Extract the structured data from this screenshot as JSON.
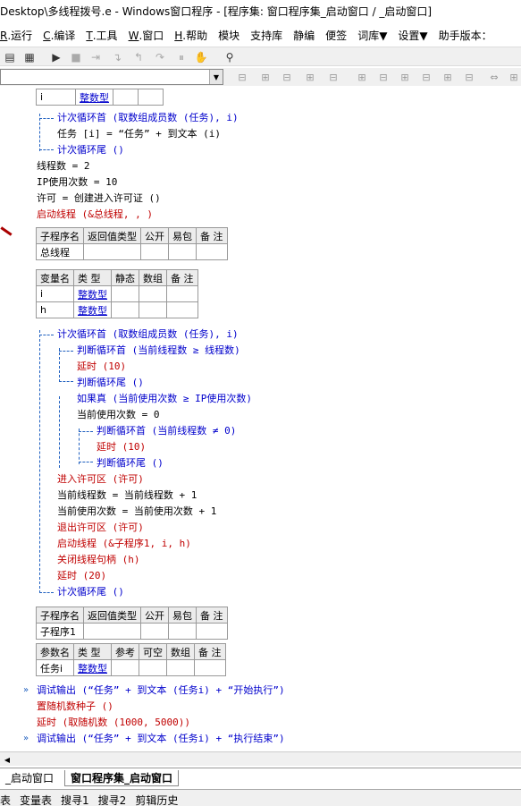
{
  "window": {
    "title": "Desktop\\多线程拨号.e - Windows窗口程序 - [程序集: 窗口程序集_启动窗口 / _启动窗口]"
  },
  "menu": {
    "items": [
      {
        "key": "R",
        "label": ".运行"
      },
      {
        "key": "C",
        "label": ".编译"
      },
      {
        "key": "T",
        "label": ".工具"
      },
      {
        "key": "W",
        "label": ".窗口"
      },
      {
        "key": "H",
        "label": ".帮助"
      },
      {
        "key": "",
        "label": "模块"
      },
      {
        "key": "",
        "label": "支持库"
      },
      {
        "key": "",
        "label": "静编"
      },
      {
        "key": "",
        "label": "便签"
      },
      {
        "key": "",
        "label": "词库▼"
      },
      {
        "key": "",
        "label": "设置▼"
      },
      {
        "key": "",
        "label": "助手版本："
      }
    ]
  },
  "toolbar": {
    "icons": [
      "layout-icon",
      "table-icon",
      "run-icon",
      "stop-icon",
      "step-icon",
      "step-into-icon",
      "step-out-icon",
      "step-over-icon",
      "pause-icon",
      "hand-icon",
      "binoculars-icon"
    ]
  },
  "code": {
    "top_table": {
      "name": "i",
      "type": "整数型"
    },
    "lines1": [
      {
        "text": "计次循环首 (取数组成员数 (任务), i)",
        "cls": "kw-blue"
      },
      {
        "text": "任务 [i] = “任务” + 到文本 (i)",
        "cls": ""
      },
      {
        "text": "计次循环尾 ()",
        "cls": "kw-blue"
      },
      {
        "text": "线程数 = 2",
        "cls": ""
      },
      {
        "text": "IP使用次数 = 10",
        "cls": ""
      },
      {
        "text": "许可 = 创建进入许可证 ()",
        "cls": ""
      },
      {
        "text": "启动线程 (&总线程, , )",
        "cls": "kw-red"
      }
    ],
    "sub_table1": {
      "headers": [
        "子程序名",
        "返回值类型",
        "公开",
        "易包",
        "备 注"
      ],
      "row": [
        "总线程",
        "",
        "",
        "",
        ""
      ]
    },
    "var_table": {
      "headers": [
        "变量名",
        "类 型",
        "静态",
        "数组",
        "备 注"
      ],
      "rows": [
        [
          "i",
          "整数型",
          "",
          "",
          ""
        ],
        [
          "h",
          "整数型",
          "",
          "",
          ""
        ]
      ]
    },
    "lines2": [
      {
        "text": "计次循环首 (取数组成员数 (任务), i)",
        "cls": "kw-blue",
        "indent": 64
      },
      {
        "text": "判断循环首 (当前线程数 ≥ 线程数)",
        "cls": "kw-blue",
        "indent": 86
      },
      {
        "text": "延时 (10)",
        "cls": "kw-red",
        "indent": 86
      },
      {
        "text": "判断循环尾 ()",
        "cls": "kw-blue",
        "indent": 86
      },
      {
        "text": "如果真 (当前使用次数 ≥ IP使用次数)",
        "cls": "kw-blue",
        "indent": 86
      },
      {
        "text": "当前使用次数 = 0",
        "cls": "",
        "indent": 86
      },
      {
        "text": "判断循环首 (当前线程数 ≠ 0)",
        "cls": "kw-blue",
        "indent": 108
      },
      {
        "text": "延时 (10)",
        "cls": "kw-red",
        "indent": 108
      },
      {
        "text": "判断循环尾 ()",
        "cls": "kw-blue",
        "indent": 108
      },
      {
        "text": "进入许可区 (许可)",
        "cls": "kw-red",
        "indent": 64
      },
      {
        "text": "当前线程数 = 当前线程数 + 1",
        "cls": "",
        "indent": 64
      },
      {
        "text": "当前使用次数 = 当前使用次数 + 1",
        "cls": "",
        "indent": 64
      },
      {
        "text": "退出许可区 (许可)",
        "cls": "kw-red",
        "indent": 64
      },
      {
        "text": "启动线程 (&子程序1, i, h)",
        "cls": "kw-red",
        "indent": 64
      },
      {
        "text": "关闭线程句柄 (h)",
        "cls": "kw-red",
        "indent": 64
      },
      {
        "text": "延时 (20)",
        "cls": "kw-red",
        "indent": 64
      },
      {
        "text": "计次循环尾 ()",
        "cls": "kw-blue",
        "indent": 64
      }
    ],
    "sub_table2": {
      "headers": [
        "子程序名",
        "返回值类型",
        "公开",
        "易包",
        "备 注"
      ],
      "row": [
        "子程序1",
        "",
        "",
        "",
        ""
      ],
      "param_headers": [
        "参数名",
        "类 型",
        "参考",
        "可空",
        "数组",
        "备 注"
      ],
      "param_row": [
        "任务i",
        "整数型",
        "",
        "",
        "",
        ""
      ]
    },
    "lines3": [
      {
        "text": "调试输出 (“任务” + 到文本 (任务i) + “开始执行”)",
        "cls": "kw-blue",
        "marker": true
      },
      {
        "text": "置随机数种子 ()",
        "cls": "kw-red",
        "marker": false
      },
      {
        "text": "延时 (取随机数 (1000, 5000))",
        "cls": "kw-red",
        "marker": false
      },
      {
        "text": "调试输出 (“任务” + 到文本 (任务i) + “执行结束”)",
        "cls": "kw-blue",
        "marker": true
      }
    ]
  },
  "tabs": {
    "items": [
      "_启动窗口",
      "窗口程序集_启动窗口"
    ],
    "active": 1
  },
  "status": {
    "items": [
      "表",
      "变量表",
      "搜寻1",
      "搜寻2",
      "剪辑历史"
    ]
  }
}
